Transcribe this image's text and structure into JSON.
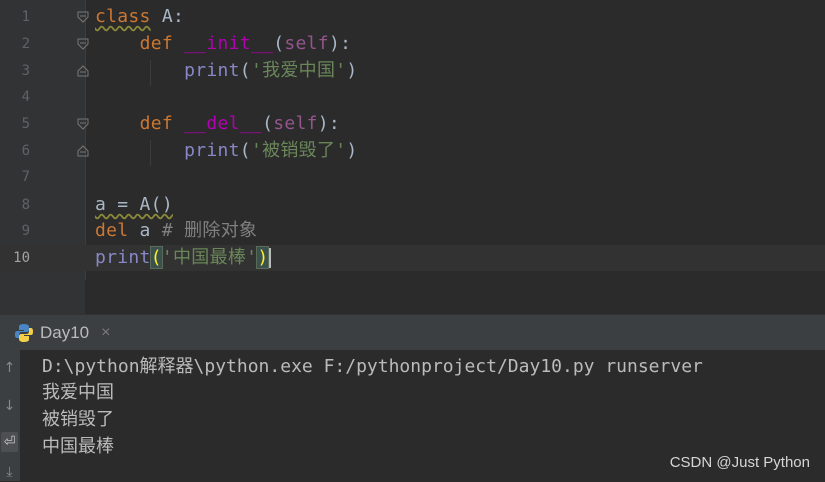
{
  "editor": {
    "line_numbers": [
      "1",
      "2",
      "3",
      "4",
      "5",
      "6",
      "7",
      "8",
      "9",
      "10"
    ],
    "lines": {
      "l1": {
        "kw": "class",
        "rest": " A:",
        "name": "A"
      },
      "l2": {
        "kw": "def",
        "fn": "__init__",
        "open": "(",
        "self": "self",
        "close": "):"
      },
      "l3": {
        "call": "print",
        "open": "(",
        "str": "'我爱中国'",
        "close": ")"
      },
      "l5": {
        "kw": "def",
        "fn": "__del__",
        "open": "(",
        "self": "self",
        "close": "):"
      },
      "l6": {
        "call": "print",
        "open": "(",
        "str": "'被销毁了'",
        "close": ")"
      },
      "l8": {
        "code": "a = A()"
      },
      "l9": {
        "kw": "del",
        "var": " a ",
        "comment": "# 删除对象"
      },
      "l10": {
        "call": "print",
        "open": "(",
        "str": "'中国最棒'",
        "close": ")"
      }
    }
  },
  "run_panel": {
    "tab_label": "Day10",
    "tab_close": "×",
    "output": [
      "D:\\python解释器\\python.exe F:/pythonproject/Day10.py runserver",
      "我爱中国",
      "被销毁了",
      "中国最棒"
    ],
    "side_buttons": [
      "↑",
      "↓",
      "⏎",
      "⤓"
    ]
  },
  "watermark": "CSDN @Just Python",
  "colors": {
    "keyword": "#cc7832",
    "string": "#6a8759",
    "builtin": "#8888c6",
    "magic": "#b200b2"
  }
}
